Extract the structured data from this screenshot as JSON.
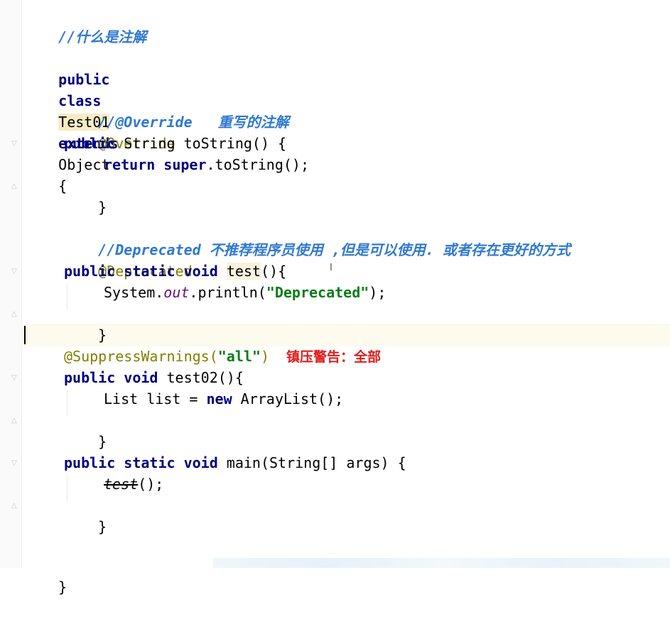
{
  "code": {
    "comment_title": "//什么是注解",
    "class_line": {
      "kw1": "public",
      "kw2": "class",
      "name": "Test01",
      "kw3": "extends",
      "parent": "Object",
      "brace": "{"
    },
    "override_comment": "//@Override   重写的注解",
    "override_ann": "@Override",
    "tostring_sig": {
      "kw": "public",
      "rest": " String toString() {"
    },
    "tostring_body": {
      "kw_return": "return",
      "kw_super": "super",
      "rest": ".toString();"
    },
    "close_brace_1": "}",
    "deprecated_comment": "//Deprecated 不推荐程序员使用 ,但是可以使用. 或者存在更好的方式",
    "deprecated_ann": "@Deprecated",
    "test_sig": {
      "kw1": "public",
      "kw2": "static",
      "kw3": "void",
      "name": "test",
      "rest": "(){"
    },
    "test_body": {
      "prefix": "System.",
      "field": "out",
      "mid": ".println(",
      "string": "\"Deprecated\"",
      "end": ");"
    },
    "close_brace_2": "}",
    "suppress_ann": {
      "prefix": "@SuppressWarnings(",
      "arg": "\"all\"",
      "suffix": ")"
    },
    "suppress_note": "镇压警告：全部",
    "test02_sig": {
      "kw1": "public",
      "kw2": "void",
      "rest": " test02(){"
    },
    "test02_body": {
      "prefix": "List list = ",
      "kw": "new",
      "rest": " ArrayList();"
    },
    "close_brace_3": "}",
    "main_sig": {
      "kw1": "public",
      "kw2": "static",
      "kw3": "void",
      "rest": " main(String[] args) {"
    },
    "main_body": {
      "call": "test",
      "rest": "();"
    },
    "close_brace_4": "}",
    "close_brace_class": "}"
  },
  "colors": {
    "keyword": "#000080",
    "comment": "#2f78d1",
    "annotation": "#808000",
    "string": "#067d17",
    "note": "#e01b1b"
  }
}
